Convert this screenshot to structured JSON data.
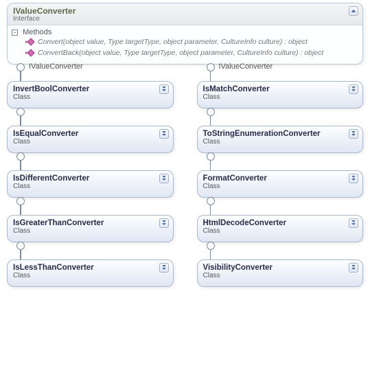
{
  "interface": {
    "name": "IValueConverter",
    "stereotype": "Interface",
    "methods_header": "Methods",
    "methods": [
      {
        "sig": "Convert(object value, Type targetType, object parameter, CultureInfo culture) : object"
      },
      {
        "sig": "ConvertBack(object value, Type targetType, object parameter, CultureInfo culture) : object"
      }
    ]
  },
  "lollipop_label": "IValueConverter",
  "class_stereotype": "Class",
  "classes": [
    {
      "name": "InvertBoolConverter",
      "show_lollipop_label": true
    },
    {
      "name": "IsMatchConverter",
      "show_lollipop_label": true
    },
    {
      "name": "IsEqualConverter",
      "show_lollipop_label": false
    },
    {
      "name": "ToStringEnumerationConverter",
      "show_lollipop_label": false
    },
    {
      "name": "IsDifferentConverter",
      "show_lollipop_label": false
    },
    {
      "name": "FormatConverter",
      "show_lollipop_label": false
    },
    {
      "name": "IsGreaterThanConverter",
      "show_lollipop_label": false
    },
    {
      "name": "HtmlDecodeConverter",
      "show_lollipop_label": false
    },
    {
      "name": "IsLessThanConverter",
      "show_lollipop_label": false
    },
    {
      "name": "VisibilityConverter",
      "show_lollipop_label": false
    }
  ]
}
